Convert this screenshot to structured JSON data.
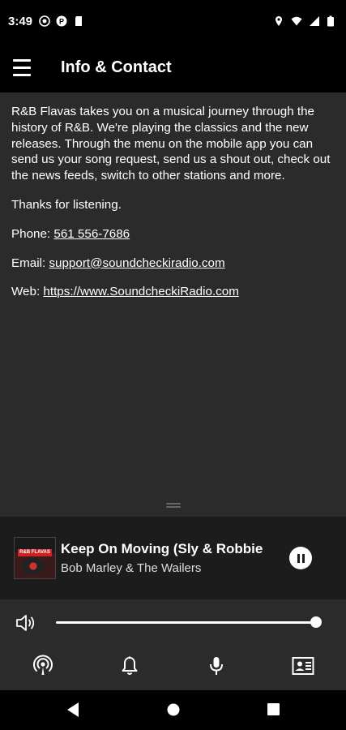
{
  "status_bar": {
    "time": "3:49",
    "left_icons": [
      "media-icon",
      "pocketcasts-icon",
      "sd-card-icon"
    ],
    "right_icons": [
      "location-icon",
      "wifi-icon",
      "signal-icon",
      "battery-icon"
    ]
  },
  "app_bar": {
    "title": "Info & Contact"
  },
  "content": {
    "description": "R&B Flavas takes you on a musical journey through the history of R&B. We're playing the classics and the new releases. Through the menu on the mobile app you can send us your song request, send us a shout out, check out the news feeds, switch to other stations and more.",
    "thanks": "Thanks for listening.",
    "phone_label": "Phone:",
    "phone_value": "561 556-7686",
    "email_label": "Email:",
    "email_value": "support@soundcheckiradio.com",
    "web_label": "Web:",
    "web_value": "https://www.SoundcheckiRadio.com"
  },
  "now_playing": {
    "title": "Keep On Moving (Sly & Robbie",
    "artist": "Bob Marley & The Wailers",
    "album_art_text": "R&B FLAVAS",
    "state": "playing"
  },
  "volume": {
    "level": 1.0
  },
  "bottom_bar": {
    "icons": [
      "podcast-icon",
      "bell-icon",
      "microphone-icon",
      "contact-card-icon"
    ]
  },
  "nav_bar": {
    "buttons": [
      "back",
      "home",
      "recents"
    ]
  },
  "colors": {
    "background": "#2b2b2b",
    "app_bar": "#000000",
    "player_bar": "#1c1c1c",
    "text": "#ffffff"
  }
}
